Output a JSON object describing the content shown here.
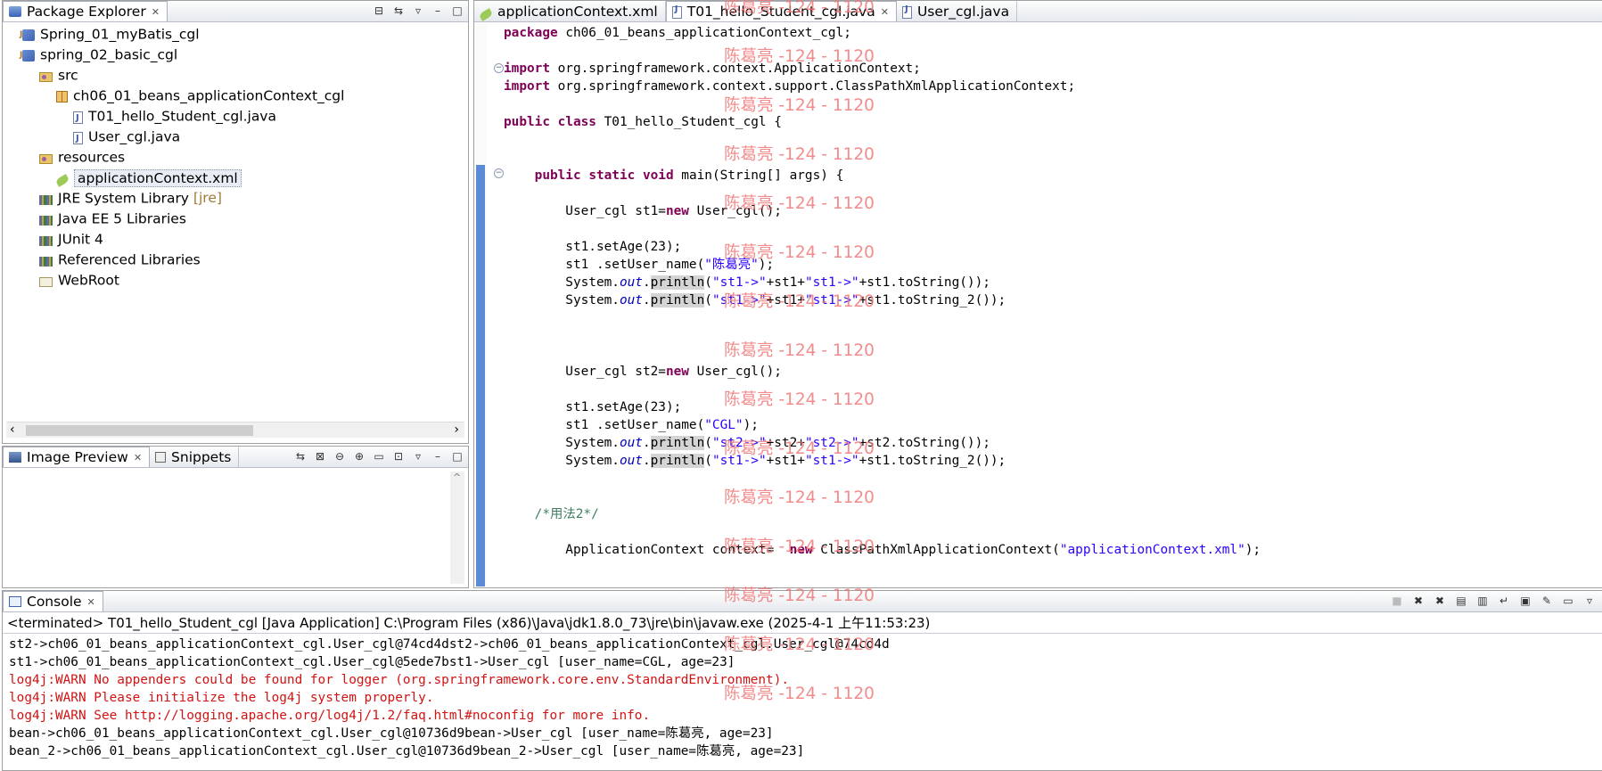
{
  "package_explorer": {
    "title": "Package Explorer",
    "items": [
      {
        "label": "Spring_01_myBatis_cgl",
        "icon": "java-project-icon",
        "depth": 0
      },
      {
        "label": "spring_02_basic_cgl",
        "icon": "java-project-icon",
        "depth": 0
      },
      {
        "label": "src",
        "icon": "source-folder-icon",
        "depth": 1
      },
      {
        "label": "ch06_01_beans_applicationContext_cgl",
        "icon": "package-icon",
        "depth": 2
      },
      {
        "label": "T01_hello_Student_cgl.java",
        "icon": "java-file-icon",
        "depth": 3
      },
      {
        "label": "User_cgl.java",
        "icon": "java-file-icon",
        "depth": 3
      },
      {
        "label": "resources",
        "icon": "source-folder-icon",
        "depth": 1
      },
      {
        "label": "applicationContext.xml",
        "icon": "xml-file-icon",
        "depth": 2
      },
      {
        "label": "JRE System Library",
        "suffix": "[jre]",
        "icon": "library-icon",
        "depth": 1
      },
      {
        "label": "Java EE 5 Libraries",
        "icon": "library-icon",
        "depth": 1
      },
      {
        "label": "JUnit 4",
        "icon": "library-icon",
        "depth": 1
      },
      {
        "label": "Referenced Libraries",
        "icon": "library-icon",
        "depth": 1
      },
      {
        "label": "WebRoot",
        "icon": "folder-icon",
        "depth": 1
      }
    ]
  },
  "image_preview": {
    "tab1": "Image Preview",
    "tab2": "Snippets"
  },
  "editor": {
    "tabs": [
      "applicationContext.xml",
      "T01_hello_Student_cgl.java",
      "User_cgl.java"
    ],
    "active_tab": 1,
    "lines": [
      "package ch06_01_beans_applicationContext_cgl;",
      "",
      "import org.springframework.context.ApplicationContext;",
      "import org.springframework.context.support.ClassPathXmlApplicationContext;",
      "",
      "public class T01_hello_Student_cgl {",
      "",
      "",
      "    public static void main(String[] args) {",
      "",
      "        User_cgl st1=new User_cgl();",
      "",
      "        st1.setAge(23);",
      "        st1 .setUser_name(\"陈葛亮\");",
      "        System.out.println(\"st1->\"+st1+\"st1->\"+st1.toString());",
      "        System.out.println(\"st1->\"+st1+\"st1->\"+st1.toString_2());",
      "",
      "",
      "",
      "        User_cgl st2=new User_cgl();",
      "",
      "        st1.setAge(23);",
      "        st1 .setUser_name(\"CGL\");",
      "        System.out.println(\"st2->\"+st2+\"st2->\"+st2.toString());",
      "        System.out.println(\"st1->\"+st1+\"st1->\"+st1.toString_2());",
      "",
      "",
      "    /*用法2*/",
      "",
      "        ApplicationContext context=  new ClassPathXmlApplicationContext(\"applicationContext.xml\");"
    ]
  },
  "watermark": "陈葛亮 -124 - 1120",
  "console": {
    "title": "Console",
    "status": "<terminated> T01_hello_Student_cgl [Java Application] C:\\Program Files (x86)\\Java\\jdk1.8.0_73\\jre\\bin\\javaw.exe (2025-4-1 上午11:53:23)",
    "lines": [
      {
        "text": "st2->ch06_01_beans_applicationContext_cgl.User_cgl@74cd4dst2->ch06_01_beans_applicationContext_cgl.User_cgl@74cd4d",
        "err": false
      },
      {
        "text": "st1->ch06_01_beans_applicationContext_cgl.User_cgl@5ede7bst1->User_cgl [user_name=CGL, age=23]",
        "err": false
      },
      {
        "text": "log4j:WARN No appenders could be found for logger (org.springframework.core.env.StandardEnvironment).",
        "err": true
      },
      {
        "text": "log4j:WARN Please initialize the log4j system properly.",
        "err": true
      },
      {
        "text": "log4j:WARN See http://logging.apache.org/log4j/1.2/faq.html#noconfig for more info.",
        "err": true
      },
      {
        "text": "bean->ch06_01_beans_applicationContext_cgl.User_cgl@10736d9bean->User_cgl [user_name=陈葛亮, age=23]",
        "err": false
      },
      {
        "text": "bean_2->ch06_01_beans_applicationContext_cgl.User_cgl@10736d9bean_2->User_cgl [user_name=陈葛亮, age=23]",
        "err": false
      }
    ]
  }
}
